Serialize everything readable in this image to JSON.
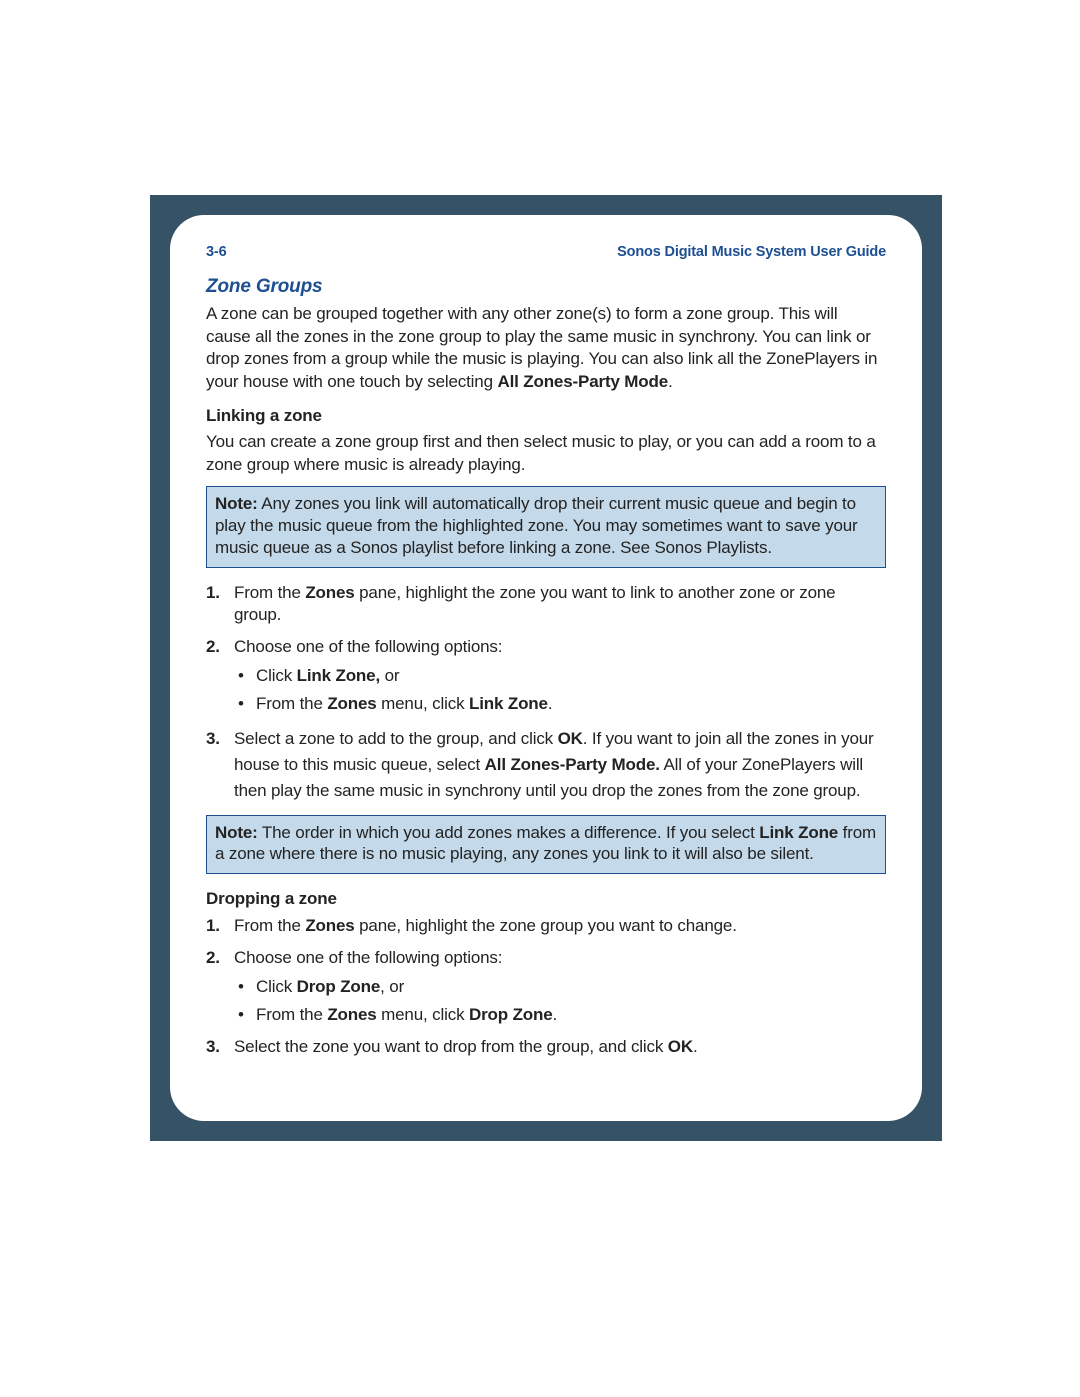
{
  "header": {
    "page_number": "3-6",
    "guide_title": "Sonos Digital Music System User Guide"
  },
  "section": {
    "title": "Zone Groups",
    "intro_pre": "A zone can be grouped together with any other zone(s) to form a zone group. This will cause all the zones in the zone group to play the same music in synchrony. You can link or drop zones from a group while the music is playing. You can also link all the ZonePlayers in your house with one touch by selecting ",
    "intro_bold": "All Zones-Party Mode",
    "intro_post": "."
  },
  "linking": {
    "heading": "Linking a zone",
    "intro": "You can create a zone group first and then select music to play, or you can add a room to a zone group where music is already playing.",
    "note_label": "Note:",
    "note_body": "  Any zones you link will automatically drop their current music queue and begin to play the music queue from the highlighted zone. You may sometimes want to save your music queue as a Sonos playlist before linking a zone. See Sonos Playlists.",
    "step1_pre": "From the ",
    "step1_b": "Zones",
    "step1_post": " pane, highlight the zone you want to link to another zone or zone group.",
    "step2": "Choose one of the following options:",
    "step2_b1_pre": "Click ",
    "step2_b1_b": "Link Zone,",
    "step2_b1_post": " or",
    "step2_b2_pre": "From the ",
    "step2_b2_b1": "Zones",
    "step2_b2_mid": " menu, click ",
    "step2_b2_b2": "Link Zone",
    "step2_b2_post": ".",
    "step3_pre": "Select a zone to add to the group, and click ",
    "step3_b1": "OK",
    "step3_mid1": ". If you want to join all the zones in your house to this music queue, select ",
    "step3_b2": "All Zones-Party Mode.",
    "step3_post": "  All of your ZonePlayers will then play the same music in synchrony until you drop the zones from the zone group.",
    "note2_label": "Note:",
    "note2_pre": "  The order in which you add zones makes a difference. If you select ",
    "note2_b": "Link Zone",
    "note2_post": " from a zone where there is no music playing, any zones you link to it will also be silent."
  },
  "dropping": {
    "heading": "Dropping a zone",
    "step1_pre": "From the ",
    "step1_b": "Zones",
    "step1_post": " pane, highlight the zone group you want to change.",
    "step2": "Choose one of the following options:",
    "step2_b1_pre": "Click ",
    "step2_b1_b": "Drop Zone",
    "step2_b1_post": ", or",
    "step2_b2_pre": "From the ",
    "step2_b2_b1": "Zones",
    "step2_b2_mid": " menu, click ",
    "step2_b2_b2": "Drop Zone",
    "step2_b2_post": ".",
    "step3_pre": "Select the zone you want to drop from the group, and click ",
    "step3_b": "OK",
    "step3_post": "."
  }
}
